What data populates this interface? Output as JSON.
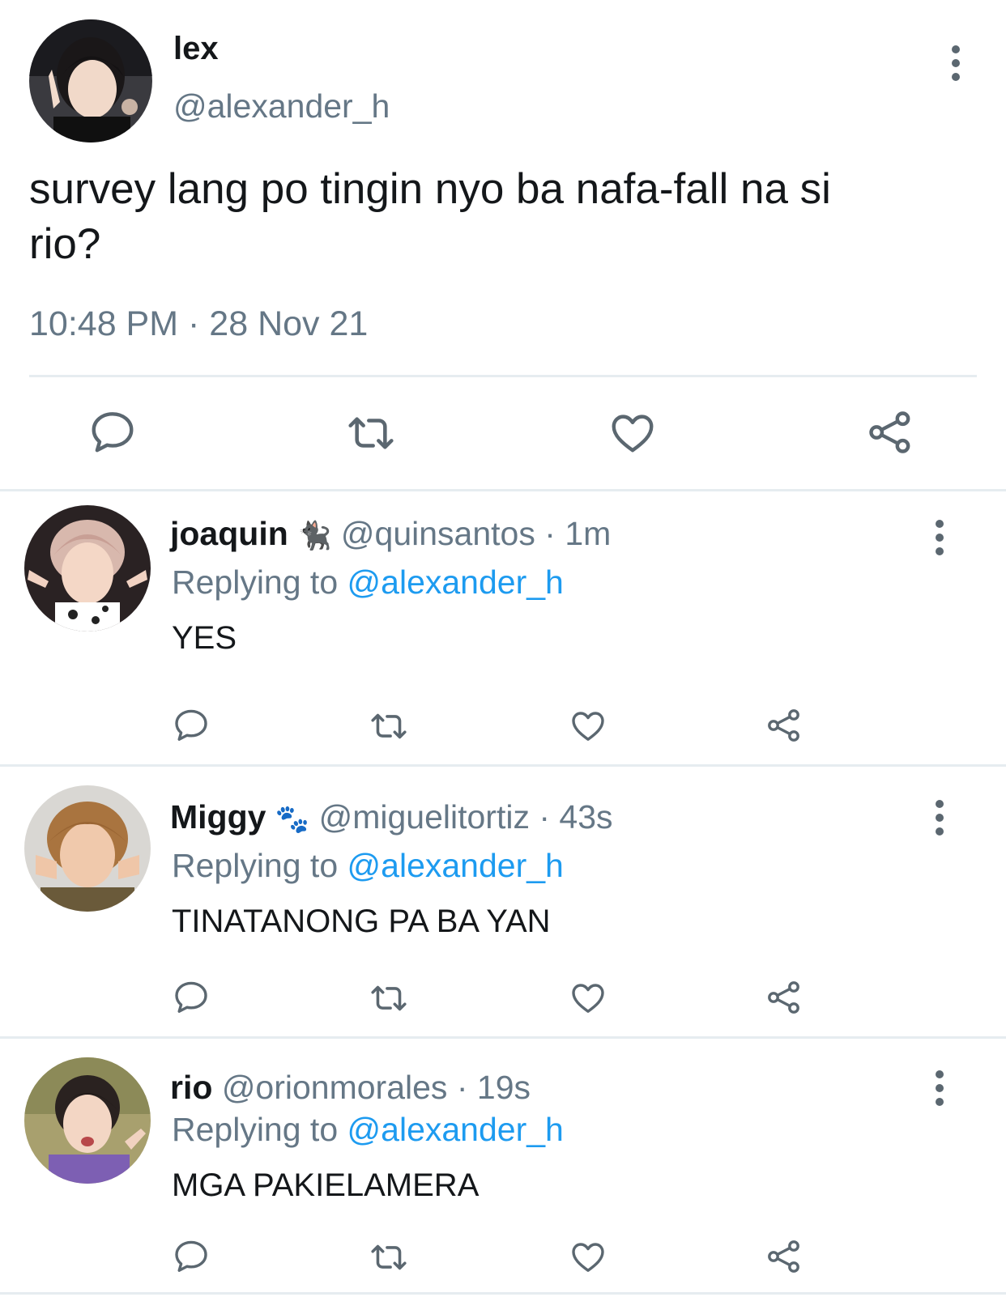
{
  "main_tweet": {
    "display_name": "lex",
    "handle": "@alexander_h",
    "text_line1": "survey lang po tingin nyo ba nafa-fall na si",
    "text_line2": "rio?",
    "time": "10:48 PM",
    "separator": "·",
    "date": "28 Nov 21"
  },
  "replies": [
    {
      "display_name": "joaquin",
      "emoji": "🐈‍⬛",
      "handle": "@quinsantos",
      "separator": "·",
      "age": "1m",
      "replying_prefix": "Replying to",
      "replying_to": "@alexander_h",
      "text": "YES"
    },
    {
      "display_name": "Miggy",
      "emoji": "🐾",
      "handle": "@miguelitortiz",
      "separator": "·",
      "age": "43s",
      "replying_prefix": "Replying to",
      "replying_to": "@alexander_h",
      "text": "TINATANONG PA BA YAN"
    },
    {
      "display_name": "rio",
      "handle": "@orionmorales",
      "separator": "·",
      "age": "19s",
      "replying_prefix": "Replying to",
      "replying_to": "@alexander_h",
      "text": "MGA PAKIELAMERA"
    }
  ],
  "icons": {
    "reply": "speech-bubble-icon",
    "retweet": "retweet-icon",
    "like": "heart-icon",
    "share": "share-icon",
    "more": "vertical-dots-icon"
  },
  "colors": {
    "text": "#14171a",
    "secondary": "#657786",
    "link": "#1d9bf0",
    "icon": "#5b6770",
    "divider": "#e6ecf0"
  }
}
